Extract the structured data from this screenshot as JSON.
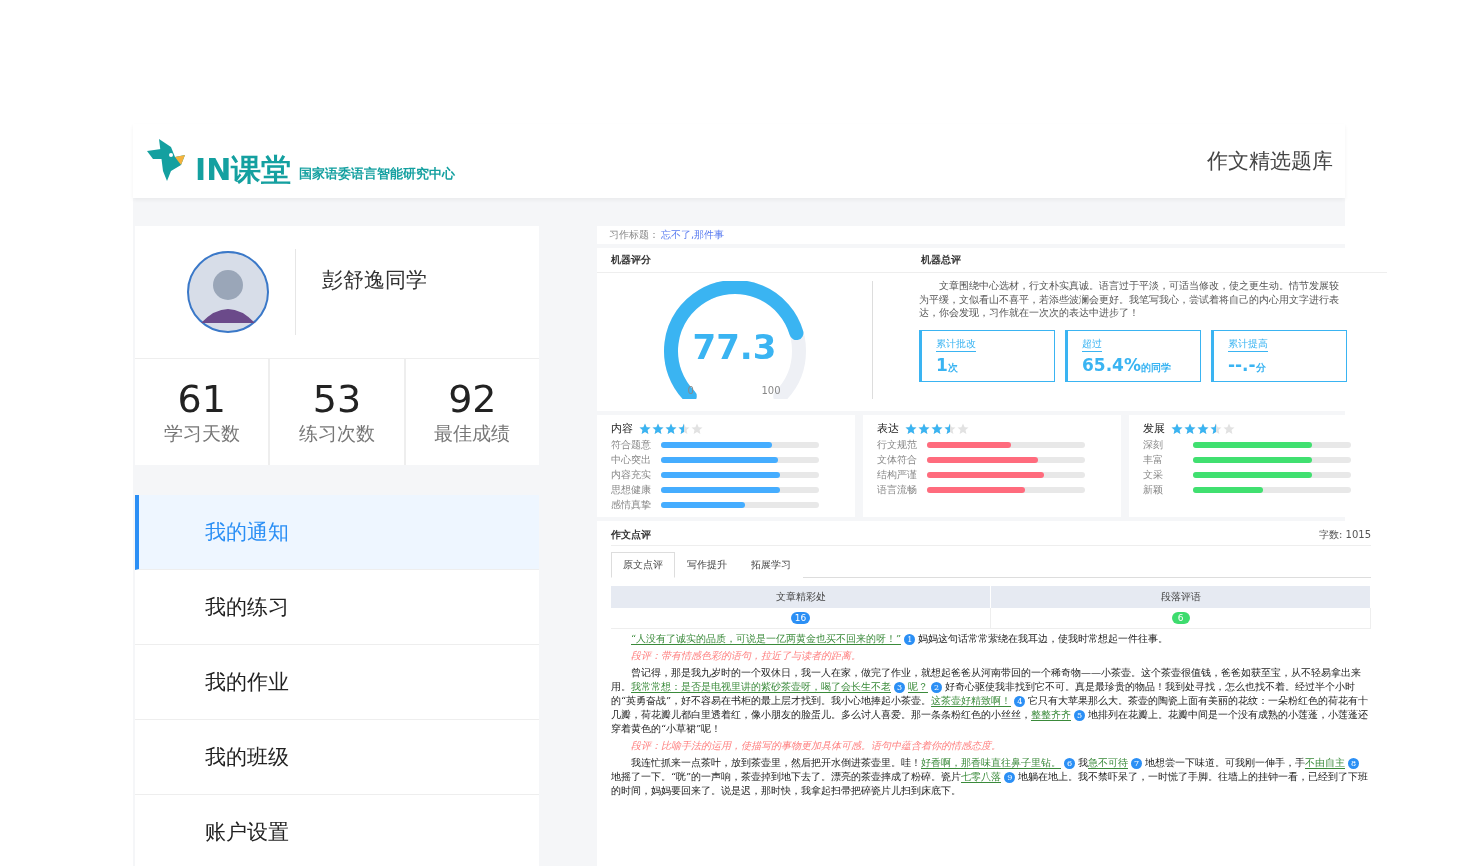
{
  "header": {
    "logo_text": "IN课堂",
    "logo_subtitle": "国家语委语言智能研究中心",
    "title": "作文精选题库"
  },
  "profile": {
    "name": "彭舒逸同学"
  },
  "stats": [
    {
      "value": "61",
      "label": "学习天数"
    },
    {
      "value": "53",
      "label": "练习次数"
    },
    {
      "value": "92",
      "label": "最佳成绩"
    }
  ],
  "menu": [
    {
      "label": "我的通知",
      "selected": true
    },
    {
      "label": "我的练习",
      "selected": false
    },
    {
      "label": "我的作业",
      "selected": false
    },
    {
      "label": "我的班级",
      "selected": false
    },
    {
      "label": "账户设置",
      "selected": false
    }
  ],
  "essay_title": {
    "label": "习作标题：",
    "value": "忘不了,那件事"
  },
  "machine_score": {
    "heading": "机器评分",
    "score": "77.3",
    "min_label": "0",
    "max_label": "100"
  },
  "machine_review": {
    "heading": "机器总评",
    "text": "文章围绕中心选材，行文朴实真诚。语言过于平淡，可适当修改，使之更生动。情节发展较为平缓，文似看山不喜平，若添些波澜会更好。我笔写我心，尝试着将自己的内心用文字进行表达，你会发现，习作就在一次次的表达中进步了！",
    "cards": [
      {
        "label": "累计批改",
        "value": "1",
        "unit": "次"
      },
      {
        "label": "超过",
        "value": "65.4%",
        "unit": "的同学"
      },
      {
        "label": "累计提高",
        "value": "--.-",
        "unit": "分"
      }
    ]
  },
  "skills": [
    {
      "name": "内容",
      "stars": 3.5,
      "color": "#45adff",
      "items": [
        {
          "label": "符合题意",
          "level": 0.7
        },
        {
          "label": "中心突出",
          "level": 0.74
        },
        {
          "label": "内容充实",
          "level": 0.75
        },
        {
          "label": "思想健康",
          "level": 0.75
        },
        {
          "label": "感情真挚",
          "level": 0.53
        }
      ]
    },
    {
      "name": "表达",
      "stars": 3.5,
      "color": "#ff6b7d",
      "items": [
        {
          "label": "行文规范",
          "level": 0.53
        },
        {
          "label": "文体符合",
          "level": 0.7
        },
        {
          "label": "结构严谨",
          "level": 0.74
        },
        {
          "label": "语言流畅",
          "level": 0.62
        }
      ]
    },
    {
      "name": "发展",
      "stars": 3.5,
      "color": "#40e070",
      "items": [
        {
          "label": "深刻",
          "level": 0.75
        },
        {
          "label": "丰富",
          "level": 0.75
        },
        {
          "label": "文采",
          "level": 0.75
        },
        {
          "label": "新颖",
          "level": 0.44
        }
      ]
    }
  ],
  "review": {
    "heading": "作文点评",
    "word_count": "字数: 1015",
    "tabs": [
      {
        "label": "原文点评",
        "selected": true
      },
      {
        "label": "写作提升",
        "selected": false
      },
      {
        "label": "拓展学习",
        "selected": false
      }
    ],
    "columns": [
      {
        "label": "文章精彩处",
        "count": "16",
        "color": "#2b8ff5"
      },
      {
        "label": "段落评语",
        "count": "6",
        "color": "#3ddc6e"
      }
    ],
    "paragraphs": [
      {
        "kind": "text",
        "segments": [
          {
            "text": "“人没有了诚实的品质，可说是一亿两黄金也买不回来的呀！”",
            "highlight": true,
            "marker": "1"
          },
          {
            "text": "妈妈这句话常常萦绕在我耳边，使我时常想起一件往事。",
            "highlight": false
          }
        ]
      },
      {
        "kind": "comment",
        "text": "段评：带有情感色彩的语句，拉近了与读者的距离。"
      },
      {
        "kind": "text",
        "segments": [
          {
            "text": "曾记得，那是我九岁时的一个双休日，我一人在家，做完了作业，就想起爸爸从河南带回的一个稀奇物——小茶壶。这个茶壶很值钱，爸爸如获至宝，从不轻易拿出来用。",
            "highlight": false
          },
          {
            "text": "我常常想：是否是电视里讲的紫砂茶壶呀，喝了会长生不老",
            "highlight": true,
            "marker": "3"
          },
          {
            "text": "呢？",
            "highlight": true,
            "marker": "2"
          },
          {
            "text": "好奇心驱使我非找到它不可。真是最珍贵的物品！我到处寻找，怎么也找不着。经过半个小时的“英勇奋战”，好不容易在书柜的最上层才找到。我小心地捧起小茶壶。",
            "highlight": false
          },
          {
            "text": "这茶壶好精致啊！",
            "highlight": true,
            "marker": "4"
          },
          {
            "text": "它只有大苹果那么大。茶壶的陶瓷上面有美丽的花纹：一朵粉红色的荷花有十几瓣，荷花瓣儿都白里透着红，像小朋友的脸蛋儿。多么讨人喜爱。那一条条粉红色的小丝丝，",
            "highlight": false
          },
          {
            "text": "整整齐齐",
            "highlight": true,
            "marker": "5"
          },
          {
            "text": "地排列在花瓣上。花瓣中间是一个没有成熟的小莲蓬，小莲蓬还穿着黄色的“小草裙”呢！",
            "highlight": false
          }
        ]
      },
      {
        "kind": "comment",
        "text": "段评：比喻手法的运用，使描写的事物更加具体可感。语句中蕴含着你的情感态度。"
      },
      {
        "kind": "text",
        "segments": [
          {
            "text": "我连忙抓来一点茶叶，放到茶壶里，然后把开水倒进茶壶里。哇！",
            "highlight": false
          },
          {
            "text": "好香啊，那香味直往鼻子里钻。",
            "highlight": true,
            "marker": "6"
          },
          {
            "text": "我",
            "highlight": false
          },
          {
            "text": "急不可待",
            "highlight": true,
            "marker": "7"
          },
          {
            "text": "地想尝一下味道。可我刚一伸手，手",
            "highlight": false
          },
          {
            "text": "不由自主",
            "highlight": true,
            "marker": "8"
          },
          {
            "text": "地摇了一下。“咣”的一声响，茶壶掉到地下去了。漂亮的茶壶摔成了粉碎。瓷片",
            "highlight": false
          },
          {
            "text": "七零八落",
            "highlight": true,
            "marker": "9"
          },
          {
            "text": "地躺在地上。我不禁吓呆了，一时慌了手脚。往墙上的挂钟一看，已经到了下班的时间，妈妈要回来了。说是迟，那时快，我拿起扫帚把碎瓷片儿扫到床底下。",
            "highlight": false
          }
        ]
      }
    ]
  }
}
